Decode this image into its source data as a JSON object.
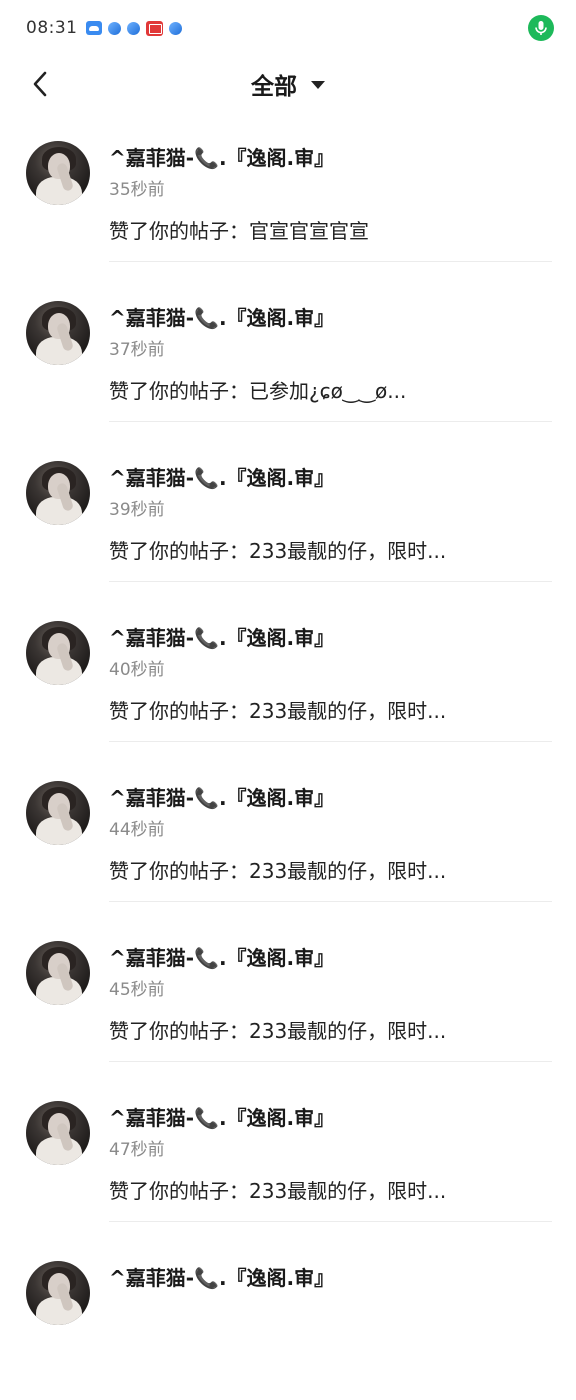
{
  "status_bar": {
    "time": "08:31",
    "icons": [
      "cloud-icon",
      "browser-icon",
      "browser-icon",
      "mail-icon",
      "browser-icon"
    ],
    "mic_color": "#1db95a"
  },
  "header": {
    "title": "全部"
  },
  "notifications": [
    {
      "name": "^嘉菲猫-📞.『逸阁.审』",
      "time": "35秒前",
      "content": "赞了你的帖子：官宣官宣官宣"
    },
    {
      "name": "^嘉菲猫-📞.『逸阁.审』",
      "time": "37秒前",
      "content": "赞了你的帖子：已参加¿ɕø‿‿ø..."
    },
    {
      "name": "^嘉菲猫-📞.『逸阁.审』",
      "time": "39秒前",
      "content": "赞了你的帖子：233最靓的仔，限时..."
    },
    {
      "name": "^嘉菲猫-📞.『逸阁.审』",
      "time": "40秒前",
      "content": "赞了你的帖子：233最靓的仔，限时..."
    },
    {
      "name": "^嘉菲猫-📞.『逸阁.审』",
      "time": "44秒前",
      "content": "赞了你的帖子：233最靓的仔，限时..."
    },
    {
      "name": "^嘉菲猫-📞.『逸阁.审』",
      "time": "45秒前",
      "content": "赞了你的帖子：233最靓的仔，限时..."
    },
    {
      "name": "^嘉菲猫-📞.『逸阁.审』",
      "time": "47秒前",
      "content": "赞了你的帖子：233最靓的仔，限时..."
    },
    {
      "name": "^嘉菲猫-📞.『逸阁.审』",
      "time": "",
      "content": ""
    }
  ]
}
